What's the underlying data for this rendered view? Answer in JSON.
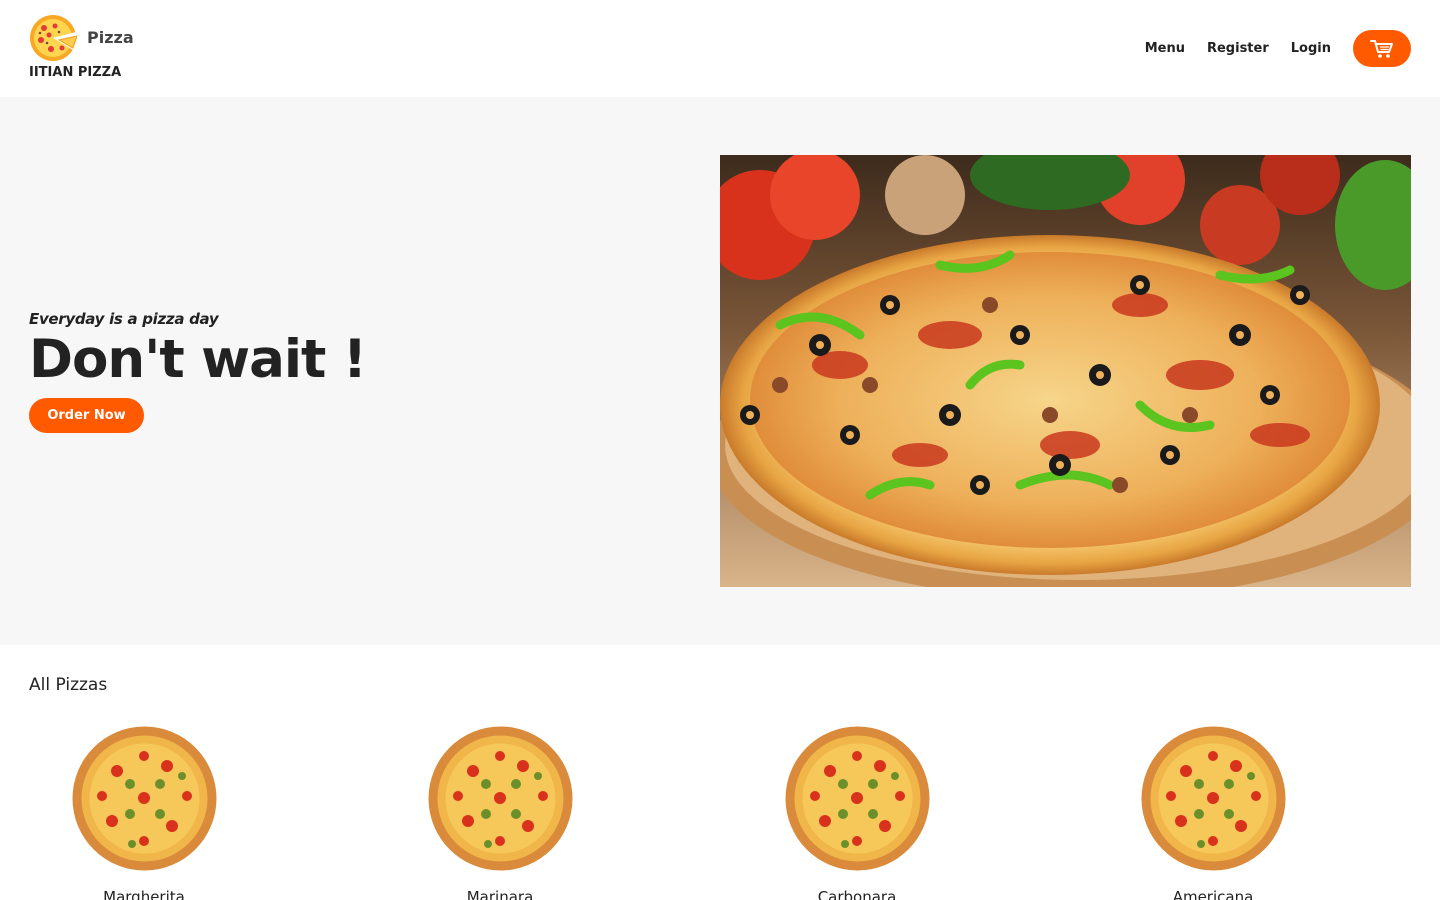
{
  "header": {
    "logo_icon": "pizza-slice-logo",
    "logo_word": "Pizza",
    "brand_name": "IITIAN PIZZA",
    "nav": {
      "menu": "Menu",
      "register": "Register",
      "login": "Login"
    },
    "cart_icon": "cart-icon"
  },
  "hero": {
    "tagline": "Everyday is a pizza day",
    "title": "Don't wait !",
    "order_button": "Order Now",
    "image": "pizza-photo"
  },
  "pizzas": {
    "title": "All Pizzas",
    "items": [
      {
        "name": "Margherita"
      },
      {
        "name": "Marinara"
      },
      {
        "name": "Carbonara"
      },
      {
        "name": "Americana"
      }
    ]
  },
  "colors": {
    "accent": "#ff5a00",
    "hero_bg": "#f7f7f7",
    "text": "#222222"
  }
}
